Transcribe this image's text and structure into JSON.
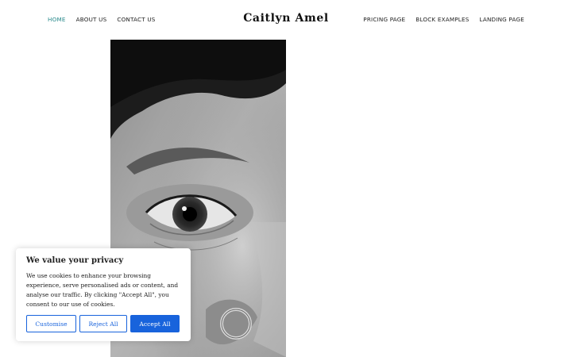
{
  "header": {
    "site_title": "Caitlyn Amel",
    "nav_left": [
      {
        "label": "HOME",
        "active": true
      },
      {
        "label": "ABOUT US",
        "active": false
      },
      {
        "label": "CONTACT US",
        "active": false
      }
    ],
    "nav_right": [
      {
        "label": "PRICING PAGE"
      },
      {
        "label": "BLOCK EXAMPLES"
      },
      {
        "label": "LANDING PAGE"
      }
    ]
  },
  "hero": {
    "image_subject": "black-and-white close-up portrait: eye and nose ring"
  },
  "cookie_banner": {
    "title": "We value your privacy",
    "body": "We use cookies to enhance your browsing experience, serve personalised ads or content, and analyse our traffic. By clicking \"Accept All\", you consent to our use of cookies.",
    "buttons": {
      "customise": "Customise",
      "reject": "Reject All",
      "accept": "Accept All"
    }
  },
  "colors": {
    "nav_active": "#2a8a8c",
    "text": "#222222",
    "button_blue": "#1863dc",
    "background": "#ffffff"
  }
}
